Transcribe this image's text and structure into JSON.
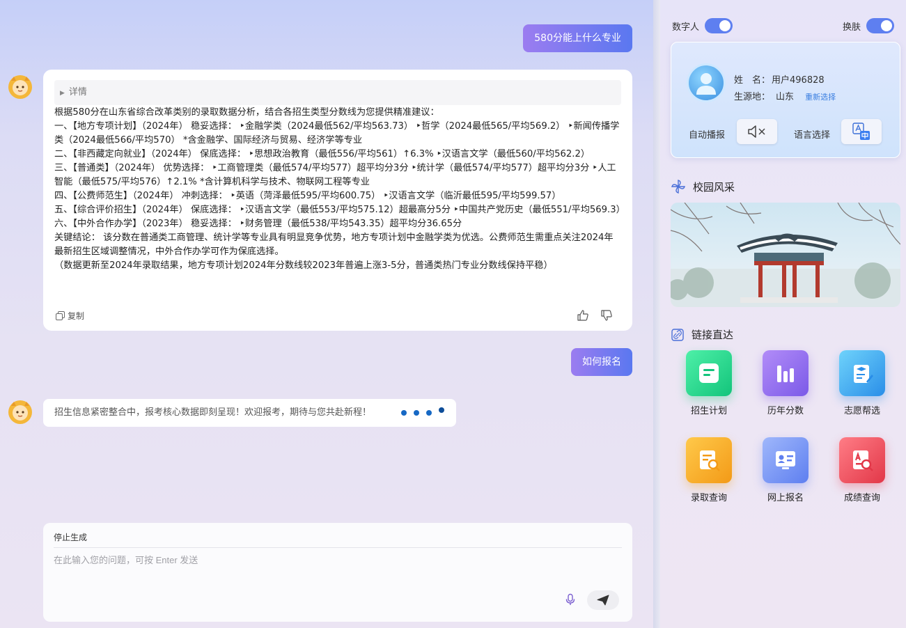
{
  "chat": {
    "user_msg_1": "580分能上什么专业",
    "details_label": "详情",
    "answer_lines": [
      "根据580分在山东省综合改革类别的录取数据分析，结合各招生类型分数线为您提供精准建议：",
      "一、【地方专项计划】（2024年） 稳妥选择： ‣金融学类（2024最低562/平均563.73） ‣哲学（2024最低565/平均569.2） ‣新闻传播学类（2024最低566/平均570） *含金融学、国际经济与贸易、经济学等专业",
      "二、【非西藏定向就业】（2024年） 保底选择： ‣思想政治教育（最低556/平均561）↑6.3% ‣汉语言文学（最低560/平均562.2）",
      "三、【普通类】（2024年） 优势选择： ‣工商管理类（最低574/平均577）超平均分3分 ‣统计学（最低574/平均577）超平均分3分 ‣人工智能（最低575/平均576）↑2.1% *含计算机科学与技术、物联网工程等专业",
      "四、【公费师范生】（2024年） 冲刺选择： ‣英语（菏泽最低595/平均600.75） ‣汉语言文学（临沂最低595/平均599.57）",
      "五、【综合评价招生】（2024年） 保底选择： ‣汉语言文学（最低553/平均575.12）超最高分5分 ‣中国共产党历史（最低551/平均569.3）",
      "六、【中外合作办学】（2023年） 稳妥选择： ‣财务管理（最低538/平均543.35）超平均分36.65分",
      "关键结论： 该分数在普通类工商管理、统计学等专业具有明显竞争优势，地方专项计划中金融学类为优选。公费师范生需重点关注2024年最新招生区域调整情况，中外合作办学可作为保底选择。",
      "（数据更新至2024年录取结果，地方专项计划2024年分数线较2023年普遍上涨3-5分，普通类热门专业分数线保持平稳）"
    ],
    "copy_label": "复制",
    "user_msg_2": "如何报名",
    "loading_msg": "招生信息紧密整合中，报考核心数据即刻呈现！欢迎报考，期待与您共赴新程！",
    "stop_label": "停止生成",
    "input_placeholder": "在此输入您的问题，可按 Enter 发送"
  },
  "panel": {
    "toggle_digital_label": "数字人",
    "toggle_digital_on": true,
    "toggle_skin_label": "换肤",
    "toggle_skin_on": true,
    "name_label": "姓　名：",
    "name_value": "用户496828",
    "origin_label": "生源地：",
    "origin_value": "山东",
    "reselect_label": "重新选择",
    "autoplay_label": "自动播报",
    "language_label": "语言选择",
    "campus_title": "校园风采",
    "links_title": "链接直达",
    "links": [
      {
        "label": "招生计划",
        "icon": "document-icon",
        "color": "#1fd38a"
      },
      {
        "label": "历年分数",
        "icon": "bar-chart-icon",
        "color": "#9a6ef2"
      },
      {
        "label": "志愿帮选",
        "icon": "grad-cap-note-icon",
        "color": "#3aa6f0"
      },
      {
        "label": "录取查询",
        "icon": "search-doc-icon",
        "color": "#f5a623"
      },
      {
        "label": "网上报名",
        "icon": "id-card-icon",
        "color": "#6d8cf5"
      },
      {
        "label": "成绩查询",
        "icon": "score-search-icon",
        "color": "#ec4a58"
      }
    ]
  }
}
